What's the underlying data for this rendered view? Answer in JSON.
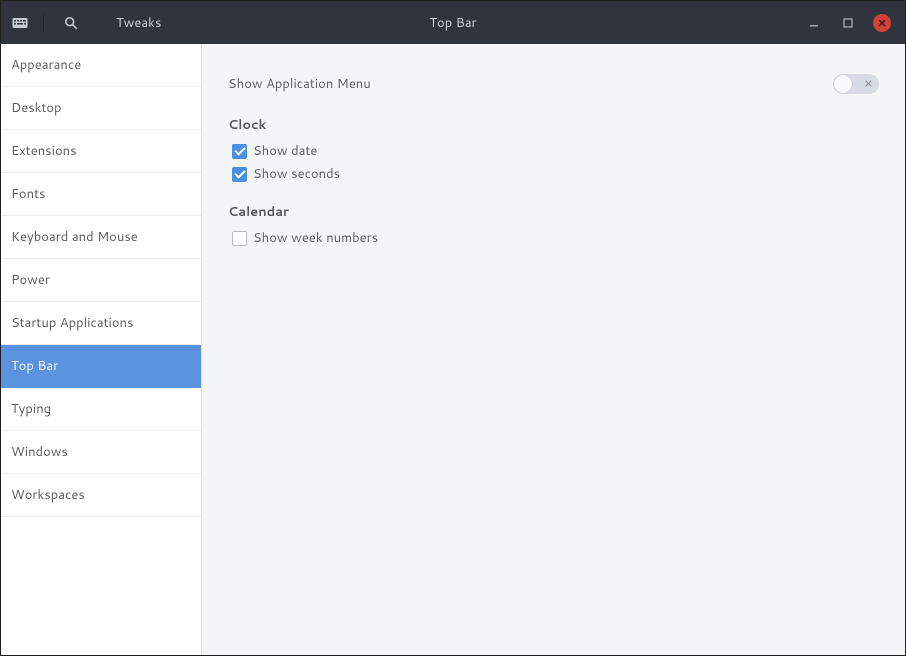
{
  "titlebar": {
    "app_name": "Tweaks",
    "page_title": "Top Bar",
    "icons": {
      "app": "keyboard-icon",
      "search": "search-icon",
      "minimize": "minimize-icon",
      "maximize": "maximize-icon",
      "close": "close-icon"
    }
  },
  "sidebar": {
    "items": [
      {
        "label": "Appearance",
        "selected": false
      },
      {
        "label": "Desktop",
        "selected": false
      },
      {
        "label": "Extensions",
        "selected": false
      },
      {
        "label": "Fonts",
        "selected": false
      },
      {
        "label": "Keyboard and Mouse",
        "selected": false
      },
      {
        "label": "Power",
        "selected": false
      },
      {
        "label": "Startup Applications",
        "selected": false
      },
      {
        "label": "Top Bar",
        "selected": true
      },
      {
        "label": "Typing",
        "selected": false
      },
      {
        "label": "Windows",
        "selected": false
      },
      {
        "label": "Workspaces",
        "selected": false
      }
    ]
  },
  "main": {
    "show_app_menu": {
      "label": "Show Application Menu",
      "value": false
    },
    "sections": [
      {
        "title": "Clock",
        "items": [
          {
            "key": "show_date",
            "label": "Show date",
            "checked": true
          },
          {
            "key": "show_seconds",
            "label": "Show seconds",
            "checked": true
          }
        ]
      },
      {
        "title": "Calendar",
        "items": [
          {
            "key": "show_week_numbers",
            "label": "Show week numbers",
            "checked": false
          }
        ]
      }
    ]
  },
  "colors": {
    "titlebar_bg": "#2f343f",
    "accent": "#5b93e0",
    "checkbox_checked": "#4a90e2",
    "close_btn": "#d1413a"
  }
}
